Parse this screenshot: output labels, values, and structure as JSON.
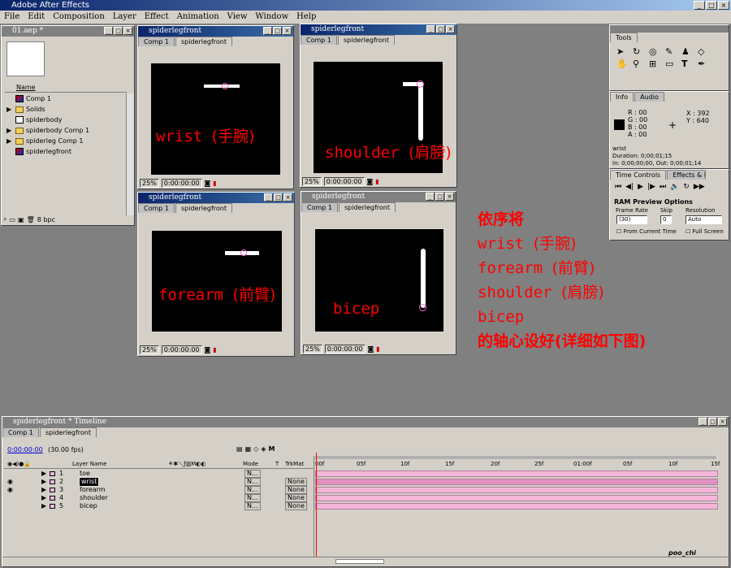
{
  "app": {
    "title": "Adobe After Effects"
  },
  "menu": [
    "File",
    "Edit",
    "Composition",
    "Layer",
    "Effect",
    "Animation",
    "View",
    "Window",
    "Help"
  ],
  "project": {
    "title": "01.aep *",
    "column_name": "Name",
    "items": [
      {
        "icon": "comp",
        "label": "Comp 1",
        "expand": false
      },
      {
        "icon": "folder",
        "label": "Solids",
        "expand": true
      },
      {
        "icon": "footage",
        "label": "spiderbody",
        "expand": false
      },
      {
        "icon": "folder",
        "label": "spiderbody Comp 1",
        "expand": true
      },
      {
        "icon": "folder",
        "label": "spiderleg Comp 1",
        "expand": true
      },
      {
        "icon": "footage",
        "label": "spiderlegfront",
        "expand": false
      }
    ],
    "bpc": "8 bpc"
  },
  "comp_windows": [
    {
      "title": "spiderlegfront",
      "tab1": "Comp 1",
      "tab2": "spiderlegfront",
      "zoom": "25%",
      "time": "0:00:00:00",
      "label": "wrist",
      "label_cn": "(手腕)"
    },
    {
      "title": "spiderlegfront",
      "tab1": "Comp 1",
      "tab2": "spiderlegfront",
      "zoom": "25%",
      "time": "0:00:00:00",
      "label": "shoulder",
      "label_cn": "(肩膀)"
    },
    {
      "title": "spiderlegfront",
      "tab1": "Comp 1",
      "tab2": "spiderlegfront",
      "zoom": "25%",
      "time": "0:00:00:00",
      "label": "forearm",
      "label_cn": "(前臂)"
    },
    {
      "title": "spiderlegfront",
      "tab1": "Comp 1",
      "tab2": "spiderlegfront",
      "zoom": "25%",
      "time": "0:00:00:00",
      "label": "bicep",
      "label_cn": ""
    }
  ],
  "annotation": {
    "line1": "依序将",
    "line2_en": "wrist",
    "line2_cn": "(手腕)",
    "line3_en": "forearm",
    "line3_cn": "(前臂)",
    "line4_en": "shoulder",
    "line4_cn": "(肩膀)",
    "line5_en": "bicep",
    "line6": "的轴心设好(详细如下图)"
  },
  "tools": {
    "title": "Tools"
  },
  "info": {
    "tab_info": "Info",
    "tab_audio": "Audio",
    "r": "R :",
    "g": "G :",
    "b": "B :",
    "a": "A :",
    "r_val": "00",
    "g_val": "00",
    "b_val": "00",
    "a_val": "00",
    "x": "X :",
    "y": "Y :",
    "x_val": "392",
    "y_val": "640",
    "layer": "wrist",
    "duration": "Duration: 0;00;01;15",
    "inout": "In: 0;00;00;00, Out: 0;00;01;14"
  },
  "time_controls": {
    "tab1": "Time Controls",
    "tab2": "Effects & Presets",
    "ram_title": "RAM Preview Options",
    "frame_rate_label": "Frame Rate",
    "skip_label": "Skip",
    "resolution_label": "Resolution",
    "frame_rate": "(30)",
    "skip": "0",
    "resolution": "Auto",
    "from_current": "From Current Time",
    "full_screen": "Full Screen"
  },
  "timeline": {
    "title": "spiderlegfront * Timeline",
    "tab1": "Comp 1",
    "tab2": "spiderlegfront",
    "time": "0:00:00:00",
    "fps": "(30.00 fps)",
    "col_layer": "Layer Name",
    "col_mode": "Mode",
    "col_t": "T",
    "col_trkmat": "TrkMat",
    "ruler": [
      "00f",
      "05f",
      "10f",
      "15f",
      "20f",
      "25f",
      "01:00f",
      "05f",
      "10f",
      "15f"
    ],
    "layers": [
      {
        "num": "1",
        "name": "toe",
        "mode": "N...",
        "trk": "",
        "selected": false
      },
      {
        "num": "2",
        "name": "wrist",
        "mode": "N...",
        "trk": "None",
        "selected": true
      },
      {
        "num": "3",
        "name": "forearm",
        "mode": "N...",
        "trk": "None",
        "selected": false
      },
      {
        "num": "4",
        "name": "shoulder",
        "mode": "N...",
        "trk": "None",
        "selected": false
      },
      {
        "num": "5",
        "name": "bicep",
        "mode": "N...",
        "trk": "None",
        "selected": false
      }
    ],
    "signature": "poo_chi"
  },
  "colors": {
    "accent_red": "#ff0000",
    "layer_bar": "#f4b6d8",
    "title_blue": "#0a246a"
  }
}
